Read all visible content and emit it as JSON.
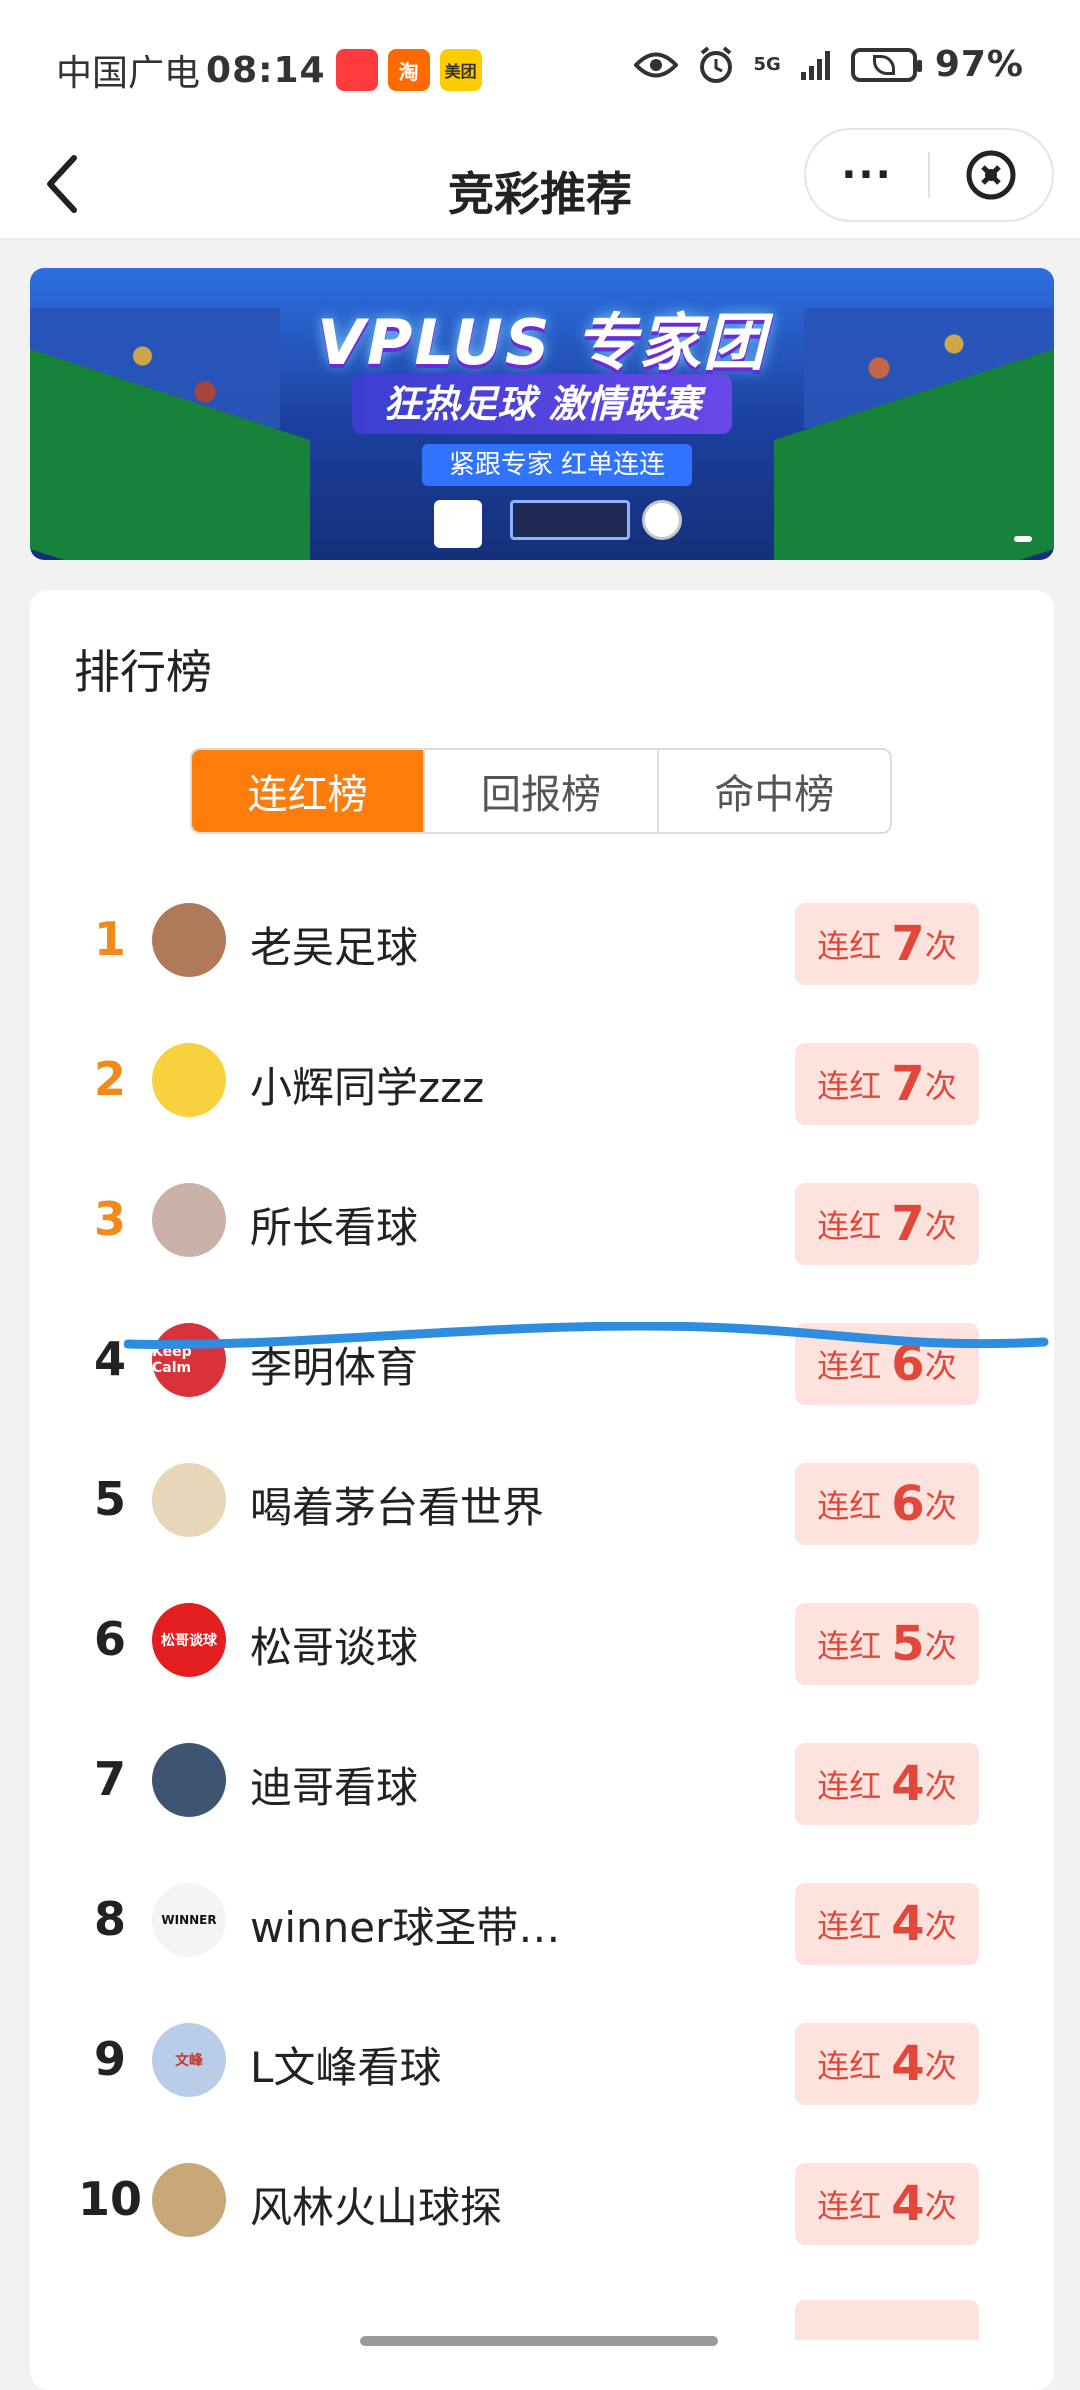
{
  "status_bar": {
    "carrier": "中国广电",
    "time": "08:14",
    "apps": [
      {
        "name": "taobao-special-app-icon",
        "label": "",
        "color": "#ff3b3b"
      },
      {
        "name": "taobao-app-icon",
        "label": "淘",
        "color": "#ff6a00"
      },
      {
        "name": "meituan-app-icon",
        "label": "美团",
        "color": "#ffcc00"
      }
    ],
    "network": "5G",
    "battery": "97%"
  },
  "nav": {
    "title": "竞彩推荐",
    "more_label": "···"
  },
  "banner": {
    "title": "VPLUS 专家团",
    "subtitle": "狂热足球 激情联赛",
    "tagline": "紧跟专家 红单连连"
  },
  "ranking": {
    "title": "排行榜",
    "tabs": [
      {
        "label": "连红榜",
        "active": true
      },
      {
        "label": "回报榜",
        "active": false
      },
      {
        "label": "命中榜",
        "active": false
      }
    ],
    "streak_label": "连红",
    "streak_unit": "次",
    "rows": [
      {
        "rank": "1",
        "name": "老吴足球",
        "streak": "7",
        "avatar_color": "#b07a5a",
        "avatar_text": ""
      },
      {
        "rank": "2",
        "name": "小辉同学zzz",
        "streak": "7",
        "avatar_color": "#f7d23e",
        "avatar_text": ""
      },
      {
        "rank": "3",
        "name": "所长看球",
        "streak": "7",
        "avatar_color": "#c9b1a8",
        "avatar_text": ""
      },
      {
        "rank": "4",
        "name": "李明体育",
        "streak": "6",
        "avatar_color": "#d8333a",
        "avatar_text": "Keep Calm"
      },
      {
        "rank": "5",
        "name": "喝着茅台看世界",
        "streak": "6",
        "avatar_color": "#e7d6b8",
        "avatar_text": ""
      },
      {
        "rank": "6",
        "name": "松哥谈球",
        "streak": "5",
        "avatar_color": "#e21e1e",
        "avatar_text": "松哥谈球"
      },
      {
        "rank": "7",
        "name": "迪哥看球",
        "streak": "4",
        "avatar_color": "#3d5570",
        "avatar_text": ""
      },
      {
        "rank": "8",
        "name": "winner球圣带…",
        "streak": "4",
        "avatar_color": "#f4f4f4",
        "avatar_text": "WINNER"
      },
      {
        "rank": "9",
        "name": "L文峰看球",
        "streak": "4",
        "avatar_color": "#b9cde8",
        "avatar_text": "文峰"
      },
      {
        "rank": "10",
        "name": "风林火山球探",
        "streak": "4",
        "avatar_color": "#c9a878",
        "avatar_text": ""
      }
    ]
  },
  "colors": {
    "accent_orange": "#ff7d0a",
    "top_rank_orange": "#f08a1c",
    "streak_bg": "#fde2dd",
    "streak_text": "#e2483a",
    "annotation_blue": "#2f8de0"
  }
}
